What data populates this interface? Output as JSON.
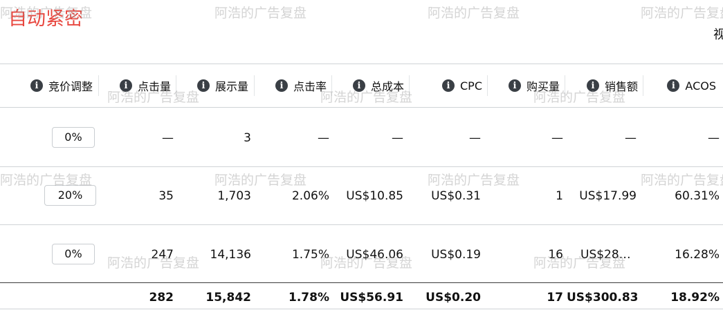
{
  "title": "自动紧密",
  "top_right_cut_text": "视",
  "watermark": "阿浩的广告复盘",
  "columns": [
    {
      "label": "竞价调整",
      "icon": "info-icon"
    },
    {
      "label": "点击量",
      "icon": "info-icon"
    },
    {
      "label": "展示量",
      "icon": "info-icon"
    },
    {
      "label": "点击率",
      "icon": "info-icon"
    },
    {
      "label": "总成本",
      "icon": "info-icon"
    },
    {
      "label": "CPC",
      "icon": "info-icon"
    },
    {
      "label": "购买量",
      "icon": "info-icon"
    },
    {
      "label": "销售额",
      "icon": "info-icon"
    },
    {
      "label": "ACOS",
      "icon": "info-icon"
    }
  ],
  "rows": [
    {
      "bid": "0%",
      "clicks": "—",
      "impressions": "3",
      "ctr": "—",
      "cost": "—",
      "cpc": "—",
      "purchases": "—",
      "sales": "—",
      "acos": "—"
    },
    {
      "bid": "20%",
      "clicks": "35",
      "impressions": "1,703",
      "ctr": "2.06%",
      "cost": "US$10.85",
      "cpc": "US$0.31",
      "purchases": "1",
      "sales": "US$17.99",
      "acos": "60.31%"
    },
    {
      "bid": "0%",
      "clicks": "247",
      "impressions": "14,136",
      "ctr": "1.75%",
      "cost": "US$46.06",
      "cpc": "US$0.19",
      "purchases": "16",
      "sales": "US$28…",
      "acos": "16.28%"
    }
  ],
  "totals": {
    "clicks": "282",
    "impressions": "15,842",
    "ctr": "1.78%",
    "cost": "US$56.91",
    "cpc": "US$0.20",
    "purchases": "17",
    "sales": "US$300.83",
    "acos": "18.92%"
  }
}
